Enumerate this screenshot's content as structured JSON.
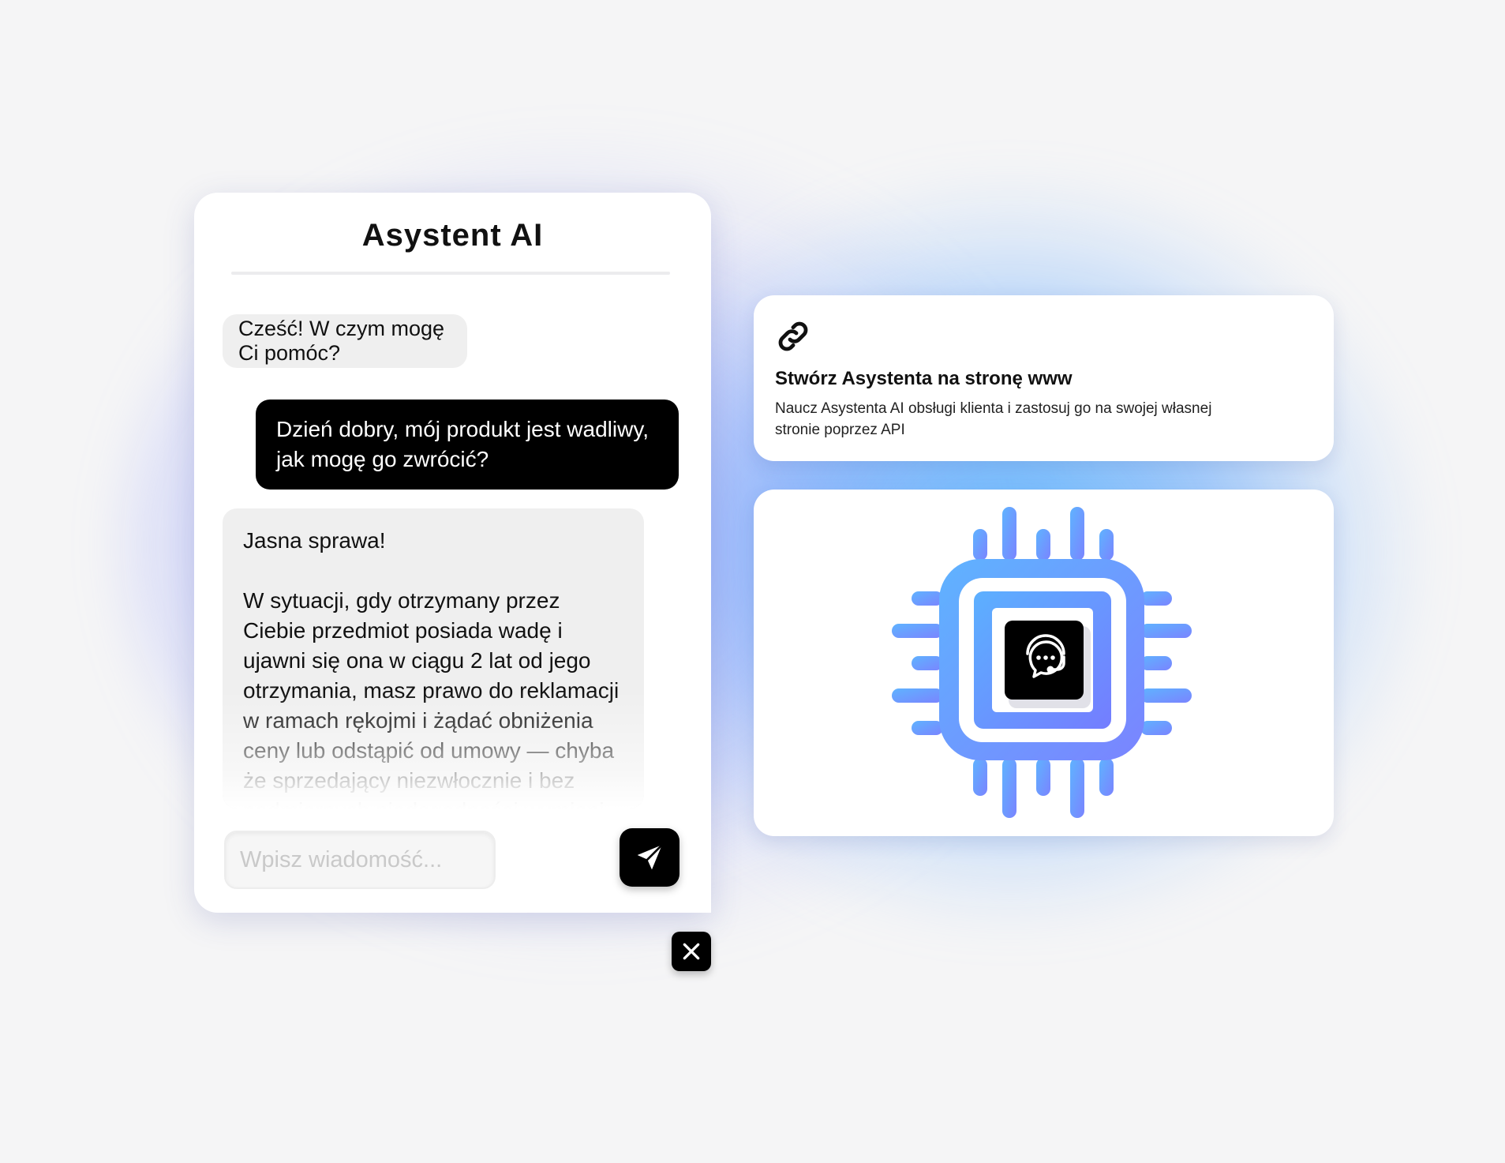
{
  "chat": {
    "title": "Asystent AI",
    "messages": [
      {
        "role": "bot",
        "text": "Cześć! W czym mogę Ci pomóc?"
      },
      {
        "role": "user",
        "text": "Dzień dobry, mój produkt jest wadliwy, jak mogę go zwrócić?"
      },
      {
        "role": "bot",
        "greeting": "Jasna sprawa!",
        "text": "W sytuacji, gdy otrzymany przez Ciebie przedmiot posiada wadę i ujawni się ona w ciągu 2 lat od jego otrzymania, masz prawo do reklamacji w ramach rękojmi i żądać obniżenia ceny lub odstąpić od umowy — chyba że sprzedający niezwłocznie i bez nadmiernych niedogodności wymieni wadliwy przedmiot"
      }
    ],
    "input_placeholder": "Wpisz wiadomość...",
    "send_icon": "paper-plane-icon",
    "close_icon": "close-icon"
  },
  "info_card": {
    "icon": "link-icon",
    "title": "Stwórz Asystenta na stronę www",
    "description": "Naucz Asystenta AI obsługi klienta i zastosuj go na swojej własnej stronie poprzez API"
  },
  "chip_card": {
    "icon": "chip-icon",
    "center_icon": "support-chat-icon",
    "gradient": [
      "#5fb0ff",
      "#7a86ff"
    ]
  },
  "colors": {
    "accent_blue": "#5aa8ff",
    "accent_violet": "#7b82ff",
    "dark": "#000000"
  }
}
